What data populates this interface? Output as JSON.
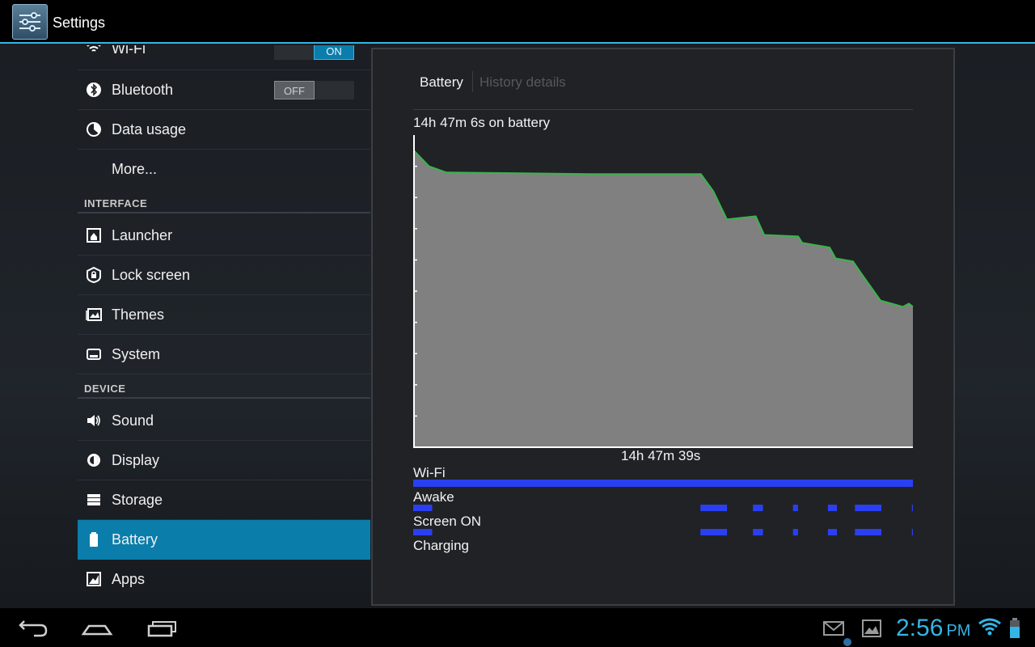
{
  "app": {
    "title": "Settings",
    "icon": "settings-sliders-icon"
  },
  "sidebar": {
    "wifi": {
      "label": "Wi-Fi",
      "toggle": "ON",
      "icon": "wifi-icon"
    },
    "bluetooth": {
      "label": "Bluetooth",
      "toggle": "OFF",
      "icon": "bluetooth-icon"
    },
    "data_usage": {
      "label": "Data usage",
      "icon": "data-usage-icon"
    },
    "more": {
      "label": "More..."
    },
    "section_interface": "INTERFACE",
    "launcher": {
      "label": "Launcher",
      "icon": "launcher-icon"
    },
    "lock_screen": {
      "label": "Lock screen",
      "icon": "lock-icon"
    },
    "themes": {
      "label": "Themes",
      "icon": "themes-icon"
    },
    "system": {
      "label": "System",
      "icon": "system-icon"
    },
    "section_device": "DEVICE",
    "sound": {
      "label": "Sound",
      "icon": "speaker-icon"
    },
    "display": {
      "label": "Display",
      "icon": "brightness-icon"
    },
    "storage": {
      "label": "Storage",
      "icon": "storage-icon"
    },
    "battery": {
      "label": "Battery",
      "icon": "battery-icon",
      "selected": true
    },
    "apps": {
      "label": "Apps",
      "icon": "apps-icon"
    }
  },
  "panel": {
    "tabs": {
      "active": "Battery",
      "inactive": "History details"
    },
    "on_battery": "14h 47m 6s on battery",
    "elapsed": "14h 47m 39s",
    "history_labels": [
      "Wi-Fi",
      "Awake",
      "Screen ON",
      "Charging"
    ]
  },
  "chart_data": {
    "type": "area",
    "x_range": [
      0,
      1
    ],
    "y_range": [
      0,
      100
    ],
    "level_points": [
      [
        0.0,
        95
      ],
      [
        0.03,
        90
      ],
      [
        0.065,
        88
      ],
      [
        0.2,
        87.8
      ],
      [
        0.35,
        87.5
      ],
      [
        0.575,
        87.5
      ],
      [
        0.6,
        82
      ],
      [
        0.627,
        73
      ],
      [
        0.685,
        74
      ],
      [
        0.702,
        68
      ],
      [
        0.77,
        67.5
      ],
      [
        0.778,
        65.5
      ],
      [
        0.833,
        64
      ],
      [
        0.845,
        60.5
      ],
      [
        0.88,
        59.5
      ],
      [
        0.895,
        56
      ],
      [
        0.935,
        47
      ],
      [
        0.98,
        45
      ],
      [
        0.992,
        46
      ],
      [
        1.0,
        45
      ]
    ],
    "fill_color": "#808080",
    "line_color": "#39b54a",
    "bar_color": "#2b3ff2",
    "tracks": {
      "wifi": [
        [
          0.0,
          1.0
        ]
      ],
      "awake": [
        [
          0.0,
          0.038
        ],
        [
          0.575,
          0.628
        ],
        [
          0.68,
          0.7
        ],
        [
          0.76,
          0.77
        ],
        [
          0.83,
          0.848
        ],
        [
          0.884,
          0.937
        ],
        [
          0.998,
          1.0
        ]
      ],
      "screen": [
        [
          0.0,
          0.038
        ],
        [
          0.575,
          0.628
        ],
        [
          0.68,
          0.7
        ],
        [
          0.76,
          0.77
        ],
        [
          0.83,
          0.848
        ],
        [
          0.884,
          0.937
        ],
        [
          0.998,
          1.0
        ]
      ],
      "charging": []
    }
  },
  "navbar": {
    "time": "2:56",
    "ampm": "PM"
  }
}
